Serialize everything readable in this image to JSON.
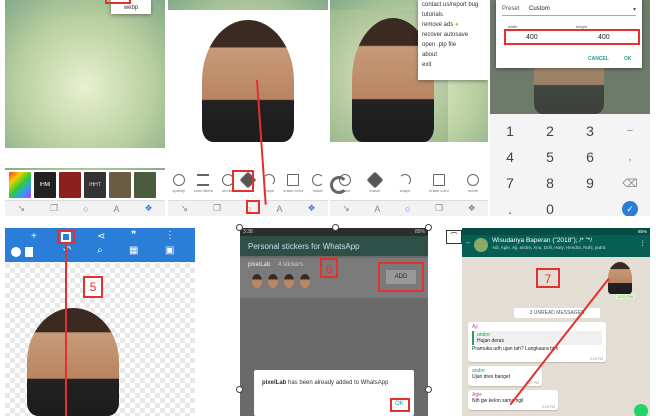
{
  "panel1": {
    "menu_item": "webp",
    "thumbnails": [
      "#d4363c",
      "#444",
      "#993333",
      "#6b6b6b",
      "#a87d4a",
      "#5b6b4b"
    ],
    "thumb_texts": [
      "IHMI",
      "",
      "",
      "IHHT",
      "",
      ""
    ]
  },
  "panel2": {
    "tools": [
      "opacity",
      "color filters",
      "stroke",
      "eraser",
      "shape",
      "erase color",
      "rotate"
    ]
  },
  "panel3": {
    "menu": [
      "contact us/report bug",
      "tutorials",
      "remove ads",
      "recover autosave",
      "open .plp file",
      "about",
      "exit"
    ],
    "tools": [
      "stroke",
      "eraser",
      "shape",
      "erase color",
      "mode"
    ]
  },
  "panel4": {
    "preset_label": "Preset",
    "preset_value": "Custom",
    "width_label": "width",
    "height_label": "height",
    "width_value": "400",
    "height_value": "400",
    "cancel": "CANCEL",
    "ok": "OK",
    "keys": [
      "1",
      "2",
      "3",
      "−",
      "4",
      "5",
      "6",
      ",",
      "7",
      "8",
      "9",
      "⌫",
      ".",
      "0",
      "",
      "✓"
    ]
  },
  "panel5": {
    "label": "5"
  },
  "panel6": {
    "time": "3:38",
    "battery": "85%",
    "title": "Personal stickers for WhatsApp",
    "pack_name": "pixelLab",
    "pack_count": "4 stickers",
    "label": "6",
    "add_button": "ADD",
    "dialog_text_app": "pixelLab",
    "dialog_text_rest": " has been already added to WhatsApp",
    "dialog_ok": "OK"
  },
  "panel7": {
    "battery": "85%",
    "group_name": "Wisudanya Baperan (\"2018\"); /* \"*/",
    "members": "Adi, Agie, Aji, andre, Anu, Dofi, Hary, Hendra, Nohi, putra",
    "sticker_time": "3:22 PM",
    "label": "7",
    "unread": "3 UNREAD MESSAGES",
    "messages": [
      {
        "who": "Aji",
        "quote_who": "andre",
        "quote": "Hujan deras",
        "text": "Pramuka udh ujan tah? Langkaura blm",
        "time": "3:26 PM"
      },
      {
        "who": "andre",
        "text": "Ujan dres banget",
        "time": "3:27 PM"
      },
      {
        "who": "Agie",
        "text": "Nih gw kelon sama ngil",
        "time": "3:26 PM"
      }
    ]
  }
}
